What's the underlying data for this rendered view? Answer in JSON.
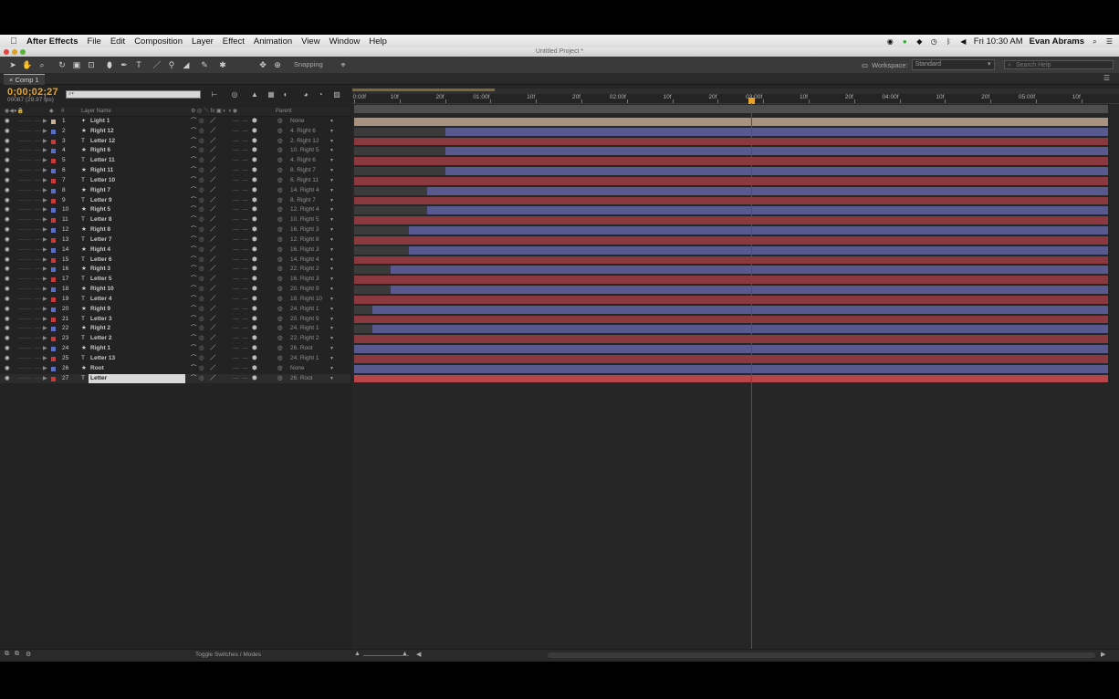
{
  "menubar": {
    "app": "After Effects",
    "items": [
      "File",
      "Edit",
      "Composition",
      "Layer",
      "Effect",
      "Animation",
      "View",
      "Window",
      "Help"
    ],
    "clock": "Fri 10:30 AM",
    "user": "Evan Abrams"
  },
  "window": {
    "title": "Untitled Project *"
  },
  "toolbar": {
    "snapping": "Snapping",
    "workspace_label": "Workspace:",
    "workspace_value": "Standard",
    "search_placeholder": "Search Help"
  },
  "comp": {
    "tab": "Comp 1",
    "timecode": "0;00;02;27",
    "frame_info": "00087 (29.97 fps)"
  },
  "columns": {
    "num": "#",
    "layer_name": "Layer Name",
    "parent": "Parent"
  },
  "ruler_ticks": [
    "0:00f",
    "10f",
    "20f",
    "01:00f",
    "10f",
    "20f",
    "02:00f",
    "10f",
    "20f",
    "03:00f",
    "10f",
    "20f",
    "04:00f",
    "10f",
    "20f",
    "05:00f",
    "10f"
  ],
  "bottom": {
    "toggle": "Toggle Switches / Modes"
  },
  "colors": {
    "red": "#8a3a3e",
    "blue": "#58598f",
    "tan": "#a89280",
    "playhead": "#c62020",
    "timecode": "#e6a22a"
  },
  "playhead_time": "02:27",
  "layers": [
    {
      "num": "1",
      "type": "light",
      "name": "Light 1",
      "label": "#c9b29a",
      "parent": "None",
      "bar": "tan",
      "start": 0
    },
    {
      "num": "2",
      "type": "star",
      "name": "Right 12",
      "label": "#5d6fc0",
      "parent": "4. Right 6",
      "bar": "blue",
      "start": 0.121
    },
    {
      "num": "3",
      "type": "text",
      "name": "Letter 12",
      "label": "#c23d3d",
      "parent": "2. Right 12",
      "bar": "red",
      "start": 0
    },
    {
      "num": "4",
      "type": "star",
      "name": "Right 6",
      "label": "#5d6fc0",
      "parent": "10. Right 5",
      "bar": "blue",
      "start": 0.121
    },
    {
      "num": "5",
      "type": "text",
      "name": "Letter 11",
      "label": "#c23d3d",
      "parent": "4. Right 6",
      "bar": "red",
      "start": 0
    },
    {
      "num": "6",
      "type": "star",
      "name": "Right 11",
      "label": "#5d6fc0",
      "parent": "8. Right 7",
      "bar": "blue",
      "start": 0.121
    },
    {
      "num": "7",
      "type": "text",
      "name": "Letter 10",
      "label": "#c23d3d",
      "parent": "6. Right 11",
      "bar": "red",
      "start": 0
    },
    {
      "num": "8",
      "type": "star",
      "name": "Right 7",
      "label": "#5d6fc0",
      "parent": "14. Right 4",
      "bar": "blue",
      "start": 0.097
    },
    {
      "num": "9",
      "type": "text",
      "name": "Letter 9",
      "label": "#c23d3d",
      "parent": "8. Right 7",
      "bar": "red",
      "start": 0
    },
    {
      "num": "10",
      "type": "star",
      "name": "Right 5",
      "label": "#5d6fc0",
      "parent": "12. Right 4",
      "bar": "blue",
      "start": 0.097
    },
    {
      "num": "11",
      "type": "text",
      "name": "Letter 8",
      "label": "#c23d3d",
      "parent": "10. Right 5",
      "bar": "red",
      "start": 0
    },
    {
      "num": "12",
      "type": "star",
      "name": "Right 8",
      "label": "#5d6fc0",
      "parent": "16. Right 3",
      "bar": "blue",
      "start": 0.073
    },
    {
      "num": "13",
      "type": "text",
      "name": "Letter 7",
      "label": "#c23d3d",
      "parent": "12. Right 8",
      "bar": "red",
      "start": 0
    },
    {
      "num": "14",
      "type": "star",
      "name": "Right 4",
      "label": "#5d6fc0",
      "parent": "16. Right 3",
      "bar": "blue",
      "start": 0.073
    },
    {
      "num": "15",
      "type": "text",
      "name": "Letter 6",
      "label": "#c23d3d",
      "parent": "14. Right 4",
      "bar": "red",
      "start": 0
    },
    {
      "num": "16",
      "type": "star",
      "name": "Right 3",
      "label": "#5d6fc0",
      "parent": "22. Right 2",
      "bar": "blue",
      "start": 0.049
    },
    {
      "num": "17",
      "type": "text",
      "name": "Letter 5",
      "label": "#c23d3d",
      "parent": "16. Right 3",
      "bar": "red",
      "start": 0
    },
    {
      "num": "18",
      "type": "star",
      "name": "Right 10",
      "label": "#5d6fc0",
      "parent": "20. Right 9",
      "bar": "blue",
      "start": 0.049
    },
    {
      "num": "19",
      "type": "text",
      "name": "Letter 4",
      "label": "#c23d3d",
      "parent": "18. Right 10",
      "bar": "red",
      "start": 0
    },
    {
      "num": "20",
      "type": "star",
      "name": "Right 9",
      "label": "#5d6fc0",
      "parent": "24. Right 1",
      "bar": "blue",
      "start": 0.024
    },
    {
      "num": "21",
      "type": "text",
      "name": "Letter 3",
      "label": "#c23d3d",
      "parent": "20. Right 9",
      "bar": "red",
      "start": 0
    },
    {
      "num": "22",
      "type": "star",
      "name": "Right 2",
      "label": "#5d6fc0",
      "parent": "24. Right 1",
      "bar": "blue",
      "start": 0.024
    },
    {
      "num": "23",
      "type": "text",
      "name": "Letter 2",
      "label": "#c23d3d",
      "parent": "22. Right 2",
      "bar": "red",
      "start": 0
    },
    {
      "num": "24",
      "type": "star",
      "name": "Right 1",
      "label": "#5d6fc0",
      "parent": "26. Root",
      "bar": "blue",
      "start": 0
    },
    {
      "num": "25",
      "type": "text",
      "name": "Letter 13",
      "label": "#c23d3d",
      "parent": "24. Right 1",
      "bar": "red",
      "start": 0
    },
    {
      "num": "26",
      "type": "star",
      "name": "Root",
      "label": "#5d6fc0",
      "parent": "None",
      "bar": "blue",
      "start": 0
    },
    {
      "num": "27",
      "type": "text",
      "name": "Letter",
      "label": "#c23d3d",
      "parent": "26. Root",
      "bar": "red",
      "start": 0,
      "selected": true
    }
  ]
}
